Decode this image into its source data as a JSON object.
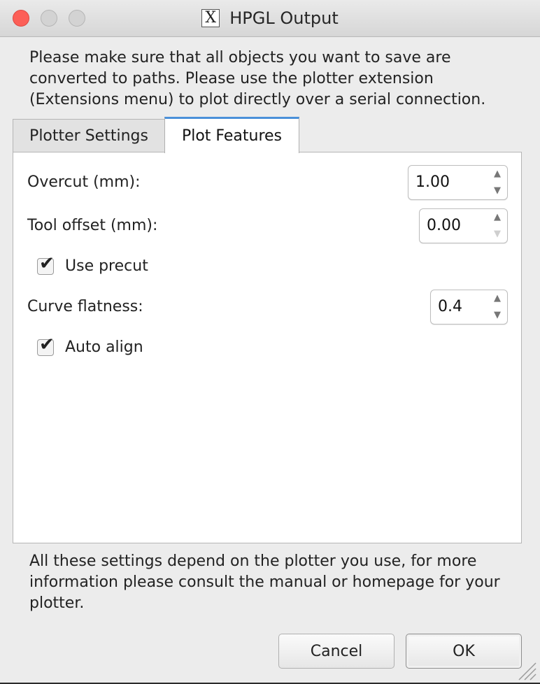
{
  "window": {
    "title": "HPGL Output",
    "app_icon": "X"
  },
  "intro_text": "Please make sure that all objects you want to save are converted to paths. Please use the plotter extension (Extensions menu) to plot directly over a serial connection.",
  "tabs": [
    {
      "label": "Plotter Settings",
      "selected": false
    },
    {
      "label": "Plot Features",
      "selected": true
    }
  ],
  "fields": {
    "overcut": {
      "label": "Overcut (mm):",
      "value": "1.00"
    },
    "tool_offset": {
      "label": "Tool offset (mm):",
      "value": "0.00"
    },
    "use_precut": {
      "label": "Use precut",
      "checked": true
    },
    "curve_flatness": {
      "label": "Curve flatness:",
      "value": "0.4"
    },
    "auto_align": {
      "label": "Auto align",
      "checked": true
    }
  },
  "footer_note": "All these settings depend on the plotter you use, for more information please consult the manual or homepage for your plotter.",
  "buttons": {
    "cancel": "Cancel",
    "ok": "OK"
  },
  "icons": {
    "up_arrow": "chevron-up-icon",
    "down_arrow": "chevron-down-icon",
    "check": "check-icon"
  },
  "colors": {
    "close_button": "#fc5f57",
    "tab_accent": "#4a90d9"
  }
}
